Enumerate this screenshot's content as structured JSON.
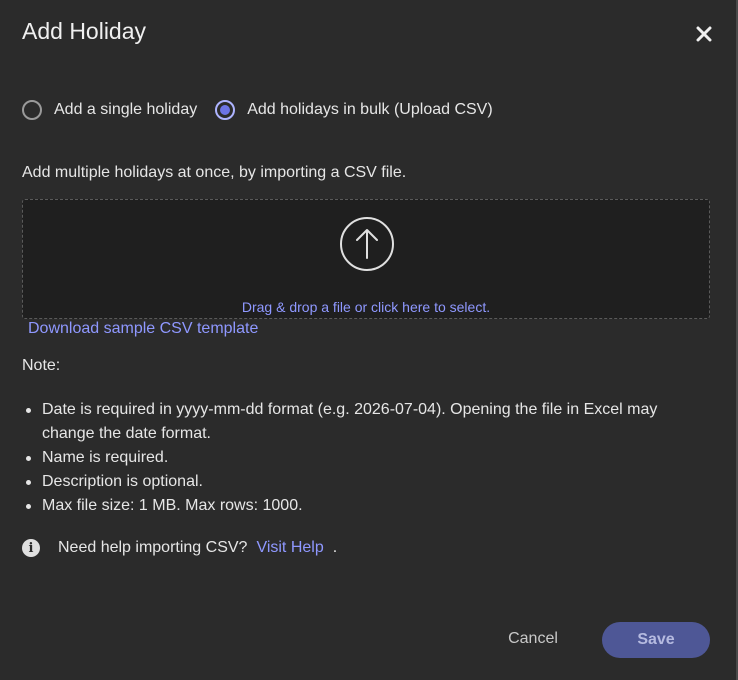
{
  "dialog": {
    "title": "Add Holiday",
    "close_icon": "close-icon"
  },
  "mode": {
    "options": [
      {
        "label": "Add a single holiday",
        "selected": false
      },
      {
        "label": "Add holidays in bulk (Upload CSV)",
        "selected": true
      }
    ]
  },
  "bulk": {
    "description": "Add multiple holidays at once, by importing a CSV file.",
    "dropzone_text": "Drag & drop a file or click here to select.",
    "upload_icon": "upload-arrow-icon",
    "download_link": "Download sample CSV template"
  },
  "notes": {
    "label": "Note:",
    "items": [
      "Date is required in yyyy-mm-dd format (e.g. 2026-07-04). Opening the file in Excel may change the date format.",
      "Name is required.",
      "Description is optional.",
      "Max file size: 1 MB. Max rows: 1000."
    ]
  },
  "help": {
    "icon": "info-icon",
    "text": "Need help importing CSV?",
    "link": "Visit Help",
    "trailing": "."
  },
  "footer": {
    "cancel_label": "Cancel",
    "save_label": "Save"
  },
  "colors": {
    "background": "#2b2b2b",
    "accent": "#8f98ff",
    "save_button": "#4e5796",
    "dropzone": "#1f1f1f"
  }
}
